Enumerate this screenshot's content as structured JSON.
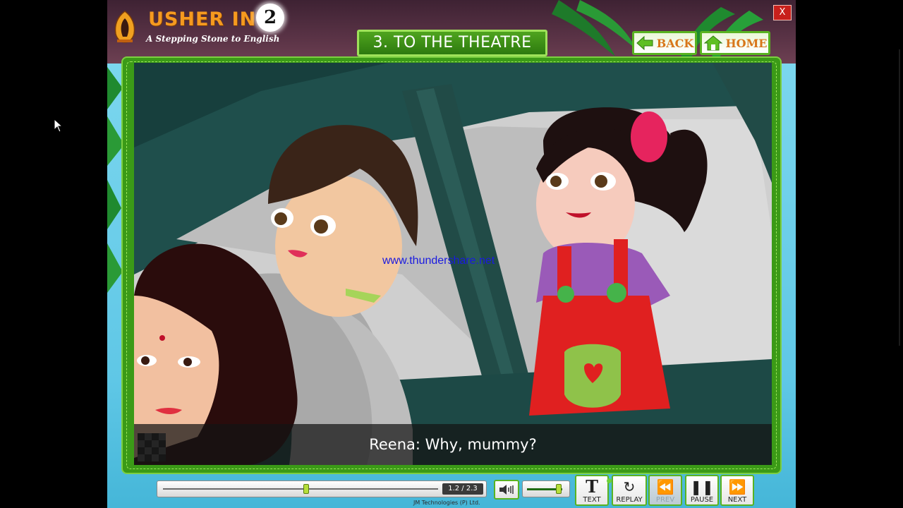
{
  "header": {
    "brand_title": "USHER IN",
    "brand_subtitle": "A Stepping Stone to English",
    "grade": "2",
    "lesson_title": "3. TO THE THEATRE",
    "back_label": "BACK",
    "home_label": "HOME",
    "close_label": "X"
  },
  "scene": {
    "watermark": "www.thundershare.net",
    "subtitle": "Reena: Why, mummy?"
  },
  "player": {
    "time_readout": "1.2 / 2.3",
    "progress_fraction": 0.52,
    "volume_fraction": 0.9,
    "buttons": {
      "text": "TEXT",
      "replay": "REPLAY",
      "prev": "PREV",
      "pause": "PAUSE",
      "next": "NEXT"
    },
    "copyright": "JM Technologies (P) Ltd."
  },
  "colors": {
    "frame_green": "#3b9a17",
    "accent_orange": "#f59a1f",
    "close_red": "#c8201c"
  }
}
